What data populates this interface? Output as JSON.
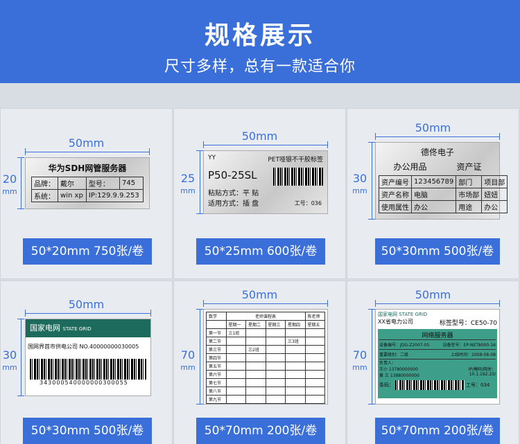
{
  "header": {
    "title": "规格展示",
    "subtitle": "尺寸多样，总有一款适合你"
  },
  "cells": [
    {
      "width": "50mm",
      "height": "20",
      "height_unit": "mm",
      "button": "50*20mm  750张/卷",
      "label": {
        "title": "华为SDH网管服务器",
        "rows": [
          [
            "品牌：",
            "戴尔",
            "型号：",
            "745"
          ],
          [
            "系统：",
            "win xp",
            "IP:129.9.9.253"
          ]
        ]
      }
    },
    {
      "width": "50mm",
      "height": "25",
      "height_unit": "mm",
      "button": "50*25mm  600张/卷",
      "label": {
        "top_left": "YY",
        "top_right": "PET哑银不干胶标签",
        "code": "P50-25SL",
        "line1": "粘贴方式：平 贴",
        "line2": "适用方式：插 盘",
        "work": "工号：036"
      }
    },
    {
      "width": "50mm",
      "height": "30",
      "height_unit": "mm",
      "button": "50*30mm  500张/卷",
      "label": {
        "company": "德佟电子",
        "tab1": "办公用品",
        "tab2": "资产证",
        "rows": [
          [
            "资产编号",
            "123456789",
            "部门",
            "项目部"
          ],
          [
            "资产名称",
            "电脑",
            "市场部",
            "妞妞"
          ],
          [
            "使用属性",
            "办公",
            "用途",
            "办公"
          ]
        ]
      }
    },
    {
      "width": "50mm",
      "height": "30",
      "height_unit": "mm",
      "button": "50*30mm  500张/卷",
      "label": {
        "brand_cn": "国家电网",
        "brand_en": "STATE GRID",
        "line": "国网界首市供电公司 NO.40000000030005",
        "barcode_text": "343000540000000300055"
      }
    },
    {
      "width": "50mm",
      "height": "70",
      "height_unit": "mm",
      "button": "50*70mm  200张/卷",
      "label": {
        "col0": "数学",
        "title": "老师课程表",
        "teacher": "陈老师",
        "days": [
          "星期一",
          "星期二",
          "星期三",
          "星期四",
          "星期五"
        ],
        "periods": [
          "第一节",
          "第二节",
          "第三节",
          "第四节",
          "第五节",
          "第六节",
          "第七节",
          "第八节",
          "第九节"
        ],
        "marks": [
          [
            "三1班",
            "",
            ""
          ],
          [
            "",
            "",
            "三3班"
          ],
          [
            "",
            "三2班",
            ""
          ]
        ]
      }
    },
    {
      "width": "50mm",
      "height": "70",
      "height_unit": "mm",
      "button": "50*70mm  200张/卷",
      "label": {
        "brand_cn": "国家电网",
        "brand_en": "STATE GRID",
        "company": "XX省电力公司",
        "model": "标签型号：CE50-70",
        "title": "网络服务器",
        "rows": [
          [
            "设备编号：JDG-Z2007-05",
            "设备型号：EP-NET8000-16"
          ],
          [
            "重要级别：二级",
            "上线时间：2008-08-08"
          ]
        ],
        "owner": "负责人：",
        "tel1": "王小 13780000000",
        "tel2": "黄  三 13880000000",
        "ip": "IP/掩码/网关：",
        "ip_val": "10.1.192.23/",
        "barcode_label": "条码：",
        "work": "工号：034"
      }
    }
  ]
}
